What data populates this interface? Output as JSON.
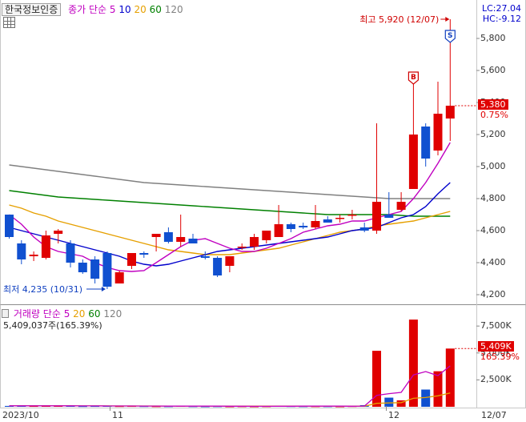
{
  "header": {
    "stock_name": "한국정보인증",
    "ma_label": "종가 단순",
    "periods": [
      "5",
      "10",
      "20",
      "60",
      "120"
    ]
  },
  "indicator": {
    "lc": "LC:27.04",
    "hc": "HC:-9.12"
  },
  "price_axis": {
    "ticks": [
      "5,800",
      "5,600",
      "5,400",
      "5,200",
      "5,000",
      "4,800",
      "4,600",
      "4,400",
      "4,200"
    ],
    "current_tag": "5,380",
    "current_change": "0.75%"
  },
  "annotations": {
    "high": "최고 5,920 (12/07)",
    "low": "최저 4,235 (10/31)",
    "buy_marker": "B",
    "sell_marker": "S"
  },
  "volume_header": {
    "label": "거래량",
    "ma_label": "단순",
    "periods": [
      "5",
      "20",
      "60",
      "120"
    ],
    "summary": "5,409,037주(165.39%)"
  },
  "volume_axis": {
    "ticks": [
      "7,500K",
      "5,000K",
      "2,500K"
    ],
    "current_tag": "5,409K",
    "current_pct": "165.39%"
  },
  "x_axis": {
    "labels": [
      "2023/10",
      "11",
      "12",
      "12/07"
    ]
  },
  "colors": {
    "up": "#e00000",
    "down": "#1050d0",
    "ma5": "#c000c0",
    "ma10": "#0000cc",
    "ma20": "#e6a000",
    "ma60": "#008000",
    "ma120": "#808080"
  },
  "chart_data": [
    {
      "type": "candlestick",
      "title": "한국정보인증",
      "ylim": [
        4150,
        5950
      ],
      "grid": false,
      "ohlc": [
        [
          4700,
          4700,
          4550,
          4560
        ],
        [
          4520,
          4540,
          4390,
          4420
        ],
        [
          4440,
          4470,
          4410,
          4450
        ],
        [
          4430,
          4600,
          4420,
          4570
        ],
        [
          4580,
          4610,
          4520,
          4600
        ],
        [
          4520,
          4540,
          4370,
          4400
        ],
        [
          4400,
          4420,
          4330,
          4340
        ],
        [
          4420,
          4440,
          4270,
          4300
        ],
        [
          4460,
          4470,
          4235,
          4250
        ],
        [
          4270,
          4350,
          4270,
          4340
        ],
        [
          4380,
          4460,
          4360,
          4460
        ],
        [
          4460,
          4470,
          4430,
          4450
        ],
        [
          4560,
          4580,
          4470,
          4580
        ],
        [
          4590,
          4620,
          4520,
          4530
        ],
        [
          4530,
          4700,
          4500,
          4560
        ],
        [
          4550,
          4580,
          4520,
          4520
        ],
        [
          4440,
          4470,
          4420,
          4430
        ],
        [
          4430,
          4440,
          4310,
          4320
        ],
        [
          4380,
          4440,
          4340,
          4440
        ],
        [
          4500,
          4520,
          4480,
          4500
        ],
        [
          4500,
          4580,
          4480,
          4560
        ],
        [
          4540,
          4600,
          4520,
          4600
        ],
        [
          4560,
          4760,
          4560,
          4640
        ],
        [
          4640,
          4650,
          4590,
          4610
        ],
        [
          4630,
          4650,
          4610,
          4620
        ],
        [
          4620,
          4760,
          4610,
          4660
        ],
        [
          4670,
          4690,
          4650,
          4650
        ],
        [
          4680,
          4700,
          4650,
          4680
        ],
        [
          4700,
          4730,
          4670,
          4700
        ],
        [
          4620,
          4650,
          4590,
          4600
        ],
        [
          4600,
          5270,
          4580,
          4780
        ],
        [
          4700,
          4840,
          4680,
          4680
        ],
        [
          4730,
          4840,
          4720,
          4780
        ],
        [
          4860,
          5590,
          4860,
          5200
        ],
        [
          5250,
          5270,
          5000,
          5050
        ],
        [
          5100,
          5530,
          5070,
          5330
        ],
        [
          5300,
          5920,
          5160,
          5380
        ]
      ],
      "ma5": [
        4700,
        4640,
        4560,
        4500,
        4470,
        4455,
        4440,
        4400,
        4370,
        4350,
        4345,
        4350,
        4400,
        4450,
        4500,
        4540,
        4550,
        4520,
        4490,
        4470,
        4470,
        4490,
        4520,
        4550,
        4590,
        4610,
        4630,
        4640,
        4660,
        4660,
        4680,
        4700,
        4720,
        4800,
        4900,
        5020,
        5150
      ],
      "ma10": [
        4620,
        4600,
        4580,
        4560,
        4540,
        4520,
        4500,
        4480,
        4460,
        4440,
        4410,
        4390,
        4380,
        4390,
        4410,
        4430,
        4450,
        4470,
        4480,
        4490,
        4500,
        4510,
        4520,
        4530,
        4540,
        4550,
        4560,
        4580,
        4600,
        4610,
        4620,
        4650,
        4680,
        4700,
        4750,
        4830,
        4900
      ],
      "ma20": [
        4760,
        4740,
        4710,
        4690,
        4660,
        4640,
        4620,
        4600,
        4580,
        4560,
        4540,
        4520,
        4500,
        4480,
        4470,
        4460,
        4450,
        4450,
        4450,
        4460,
        4470,
        4480,
        4490,
        4510,
        4530,
        4550,
        4570,
        4590,
        4600,
        4610,
        4630,
        4640,
        4650,
        4660,
        4680,
        4700,
        4720
      ],
      "ma60": [
        4850,
        4840,
        4830,
        4820,
        4810,
        4805,
        4800,
        4795,
        4790,
        4785,
        4780,
        4775,
        4770,
        4765,
        4760,
        4755,
        4750,
        4745,
        4740,
        4735,
        4730,
        4725,
        4720,
        4715,
        4710,
        4705,
        4700,
        4700,
        4700,
        4700,
        4700,
        4700,
        4695,
        4690,
        4690,
        4690,
        4690
      ],
      "ma120": [
        5010,
        5000,
        4990,
        4980,
        4970,
        4960,
        4950,
        4940,
        4930,
        4920,
        4910,
        4900,
        4895,
        4890,
        4885,
        4880,
        4875,
        4870,
        4865,
        4860,
        4855,
        4850,
        4845,
        4840,
        4835,
        4830,
        4825,
        4820,
        4815,
        4810,
        4805,
        4800,
        4800,
        4800,
        4800,
        4800,
        4800
      ]
    },
    {
      "type": "bar",
      "title": "거래량",
      "ylim": [
        0,
        9000
      ],
      "grid": false,
      "values": [
        80,
        90,
        70,
        100,
        90,
        80,
        60,
        70,
        100,
        60,
        70,
        60,
        50,
        50,
        80,
        50,
        40,
        50,
        40,
        50,
        40,
        50,
        80,
        60,
        50,
        50,
        50,
        40,
        60,
        150,
        5200,
        850,
        600,
        8100,
        1600,
        3300,
        5409
      ],
      "ma5": [
        90,
        90,
        88,
        86,
        86,
        86,
        84,
        80,
        78,
        74,
        72,
        70,
        66,
        62,
        62,
        60,
        58,
        56,
        54,
        50,
        48,
        46,
        50,
        54,
        56,
        58,
        58,
        56,
        54,
        70,
        1060,
        1220,
        1340,
        2960,
        3270,
        2890,
        3800
      ],
      "ma20": [
        90,
        90,
        90,
        88,
        88,
        86,
        84,
        82,
        80,
        78,
        76,
        74,
        72,
        70,
        68,
        66,
        64,
        62,
        60,
        58,
        58,
        58,
        58,
        58,
        56,
        56,
        56,
        55,
        55,
        58,
        320,
        360,
        390,
        790,
        860,
        1020,
        1280
      ]
    }
  ]
}
